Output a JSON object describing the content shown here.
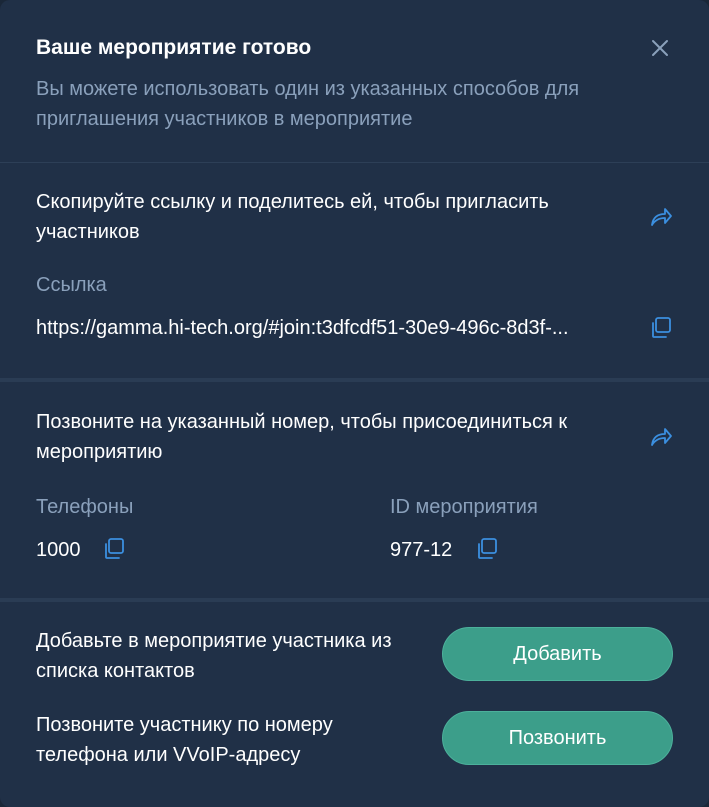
{
  "dialog": {
    "title": "Ваше мероприятие готово",
    "subtitle": "Вы можете использовать один из указанных способов для приглашения участников в мероприятие",
    "close_icon": "close-icon"
  },
  "link_section": {
    "text": "Скопируйте ссылку и поделитесь ей, чтобы  пригласить участников",
    "share_icon": "share-icon",
    "label": "Ссылка",
    "value": "https://gamma.hi-tech.org/#join:t3dfcdf51-30e9-496c-8d3f-...",
    "copy_icon": "copy-icon"
  },
  "phone_section": {
    "text": "Позвоните на указанный номер, чтобы присоединиться к мероприятию",
    "share_icon": "share-icon",
    "phones_label": "Телефоны",
    "phones_value": "1000",
    "event_id_label": "ID мероприятия",
    "event_id_value": "977-12"
  },
  "actions": {
    "add_text": "Добавьте в мероприятие участника из списка контактов",
    "add_button": "Добавить",
    "call_text": "Позвоните участнику по номеру телефона или VVoIP-адресу",
    "call_button": "Позвонить"
  },
  "colors": {
    "background": "#203047",
    "accent": "#3c9e8a",
    "icon_blue": "#3b8fe0",
    "muted_text": "#8aa0bb"
  }
}
